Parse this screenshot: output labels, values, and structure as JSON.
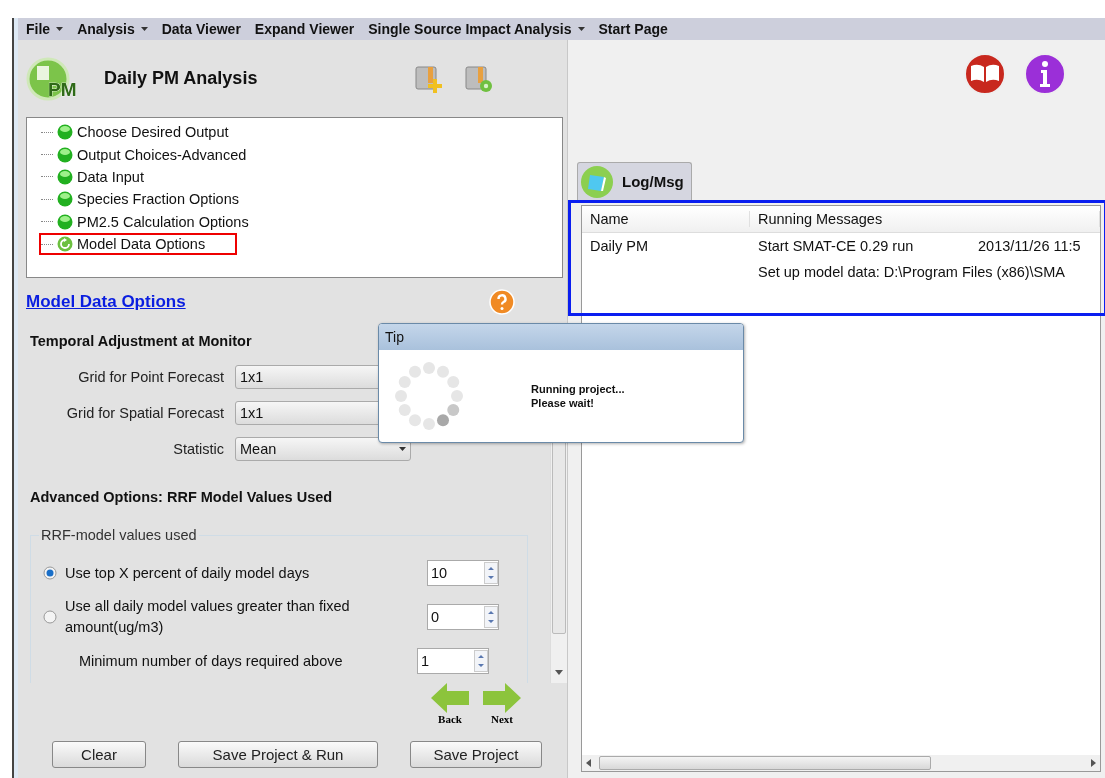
{
  "menu": [
    {
      "label": "File",
      "dropdown": true
    },
    {
      "label": "Analysis",
      "dropdown": true
    },
    {
      "label": "Data Viewer",
      "dropdown": false
    },
    {
      "label": "Expand Viewer",
      "dropdown": false
    },
    {
      "label": "Single Source Impact Analysis",
      "dropdown": true
    },
    {
      "label": "Start Page",
      "dropdown": false
    }
  ],
  "panel": {
    "logo_text": "PM",
    "title": "Daily PM Analysis",
    "steps": [
      {
        "label": "Choose Desired Output",
        "kind": "done",
        "selected": false
      },
      {
        "label": "Output Choices-Advanced",
        "kind": "done",
        "selected": false
      },
      {
        "label": "Data Input",
        "kind": "done",
        "selected": false
      },
      {
        "label": "Species Fraction Options",
        "kind": "done",
        "selected": false
      },
      {
        "label": "PM2.5 Calculation Options",
        "kind": "done",
        "selected": false
      },
      {
        "label": "Model Data Options",
        "kind": "current",
        "selected": true
      }
    ],
    "section_link": "Model Data Options",
    "temporal": {
      "heading": "Temporal Adjustment at Monitor",
      "fields": [
        {
          "label": "Grid for Point Forecast",
          "value": "1x1"
        },
        {
          "label": "Grid for Spatial Forecast",
          "value": "1x1"
        },
        {
          "label": "Statistic",
          "value": "Mean"
        }
      ]
    },
    "advanced": {
      "heading": "Advanced Options: RRF Model Values Used",
      "group_title": "RRF-model values used",
      "options": [
        {
          "kind": "radio",
          "label": "Use  top X percent of daily model days",
          "value": "10",
          "selected": true
        },
        {
          "kind": "radio",
          "label": "Use all daily model values greater than fixed amount(ug/m3)",
          "value": "0",
          "selected": false
        },
        {
          "kind": "plain",
          "label": "Minimum number of days required above",
          "value": "1"
        }
      ]
    },
    "nav": {
      "back": "Back",
      "next": "Next"
    },
    "buttons": [
      "Clear",
      "Save Project & Run",
      "Save Project"
    ]
  },
  "log": {
    "tab": "Log/Msg",
    "columns": [
      "Name",
      "Running Messages"
    ],
    "rows": [
      {
        "name": "Daily PM",
        "message": "Start SMAT-CE 0.29 run",
        "time": "2013/11/26 11:5"
      },
      {
        "message": "Set up model data: D:\\Program Files (x86)\\SMA"
      }
    ]
  },
  "tip": {
    "title": "Tip",
    "lines": [
      "Running project...",
      "Please wait!"
    ]
  }
}
